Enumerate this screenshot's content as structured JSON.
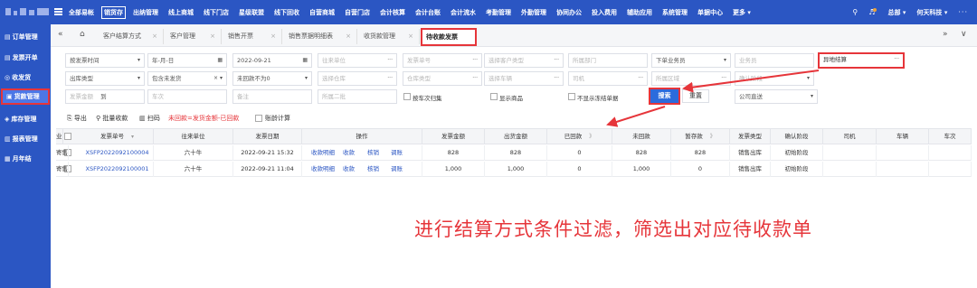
{
  "topbar": {
    "nav": [
      "全部易帐",
      "销货存",
      "出纳管理",
      "线上商城",
      "线下门店",
      "星级联盟",
      "线下回收",
      "自营商城",
      "自营门店",
      "会计核算",
      "会计台账",
      "会计流水",
      "考勤管理",
      "外勤管理",
      "协同办公",
      "投入费用",
      "辅助应用",
      "系统管理",
      "单据中心",
      "更多 ▾"
    ],
    "active_index": 1,
    "user": "总部 ▾",
    "company": "何天科技 ▾",
    "ellipsis": "···"
  },
  "sidebar": {
    "items": [
      {
        "icon": "▤",
        "label": "订单管理"
      },
      {
        "icon": "▤",
        "label": "发票开单"
      },
      {
        "icon": "◎",
        "label": "收发货"
      },
      {
        "icon": "▣",
        "label": "货款管理"
      },
      {
        "icon": "◈",
        "label": "库存管理"
      },
      {
        "icon": "▥",
        "label": "报表管理"
      },
      {
        "icon": "▦",
        "label": "月年结"
      }
    ],
    "active_index": 3
  },
  "tabs": {
    "back": "«",
    "forward": "»",
    "more": "∨",
    "items": [
      {
        "label": "客户结算方式",
        "close": "×"
      },
      {
        "label": "客户管理",
        "close": "×"
      },
      {
        "label": "销售开票",
        "close": "×"
      },
      {
        "label": "销售票据明细表",
        "close": "×"
      },
      {
        "label": "收货款管理",
        "close": "×"
      },
      {
        "label": "待收款发票",
        "close": "×"
      }
    ],
    "active_index": 5
  },
  "filters": {
    "row1": [
      {
        "text": "按发票时间",
        "suffix": "▾",
        "placeholder": false
      },
      {
        "text": "年-月-日",
        "suffix": "▦",
        "placeholder": false
      },
      {
        "text": "2022-09-21",
        "suffix": "▦",
        "placeholder": false
      },
      {
        "text": "往来单位",
        "suffix": "···",
        "placeholder": true
      },
      {
        "text": "发票单号",
        "suffix": "···",
        "placeholder": true
      },
      {
        "text": "选择客户类型",
        "suffix": "···",
        "placeholder": true
      },
      {
        "text": "所属部门",
        "suffix": "",
        "placeholder": true
      },
      {
        "text": "下单业务员",
        "suffix": "▾",
        "placeholder": false
      },
      {
        "text": "业务员",
        "suffix": "",
        "placeholder": true
      },
      {
        "text": "异地结算",
        "suffix": "···",
        "placeholder": false,
        "highlight": true
      }
    ],
    "row2": [
      {
        "text": "出库类型",
        "suffix": "▾",
        "placeholder": false
      },
      {
        "text": "包含未发货",
        "suffix": "×  ▾",
        "placeholder": false
      },
      {
        "text": "未回款不为0",
        "suffix": "▾",
        "placeholder": false
      },
      {
        "text": "选择仓库",
        "suffix": "···",
        "placeholder": true
      },
      {
        "text": "仓库类型",
        "suffix": "···",
        "placeholder": true
      },
      {
        "text": "选择车辆",
        "suffix": "···",
        "placeholder": true
      },
      {
        "text": "司机",
        "suffix": "···",
        "placeholder": true
      },
      {
        "text": "所属区域",
        "suffix": "···",
        "placeholder": true
      },
      {
        "text": "确认阶段",
        "suffix": "▾",
        "placeholder": true
      }
    ],
    "row3": {
      "amount_label": "发票金额",
      "amount_to": "到",
      "car_times": "车次",
      "remark": "备注",
      "level2": "所属二批",
      "group_by_car": "按车次归集",
      "show_goods": "显示商品",
      "hide_cleared": "不显示冻结单据",
      "search": "搜索",
      "reset": "重置",
      "company": "公司直送"
    }
  },
  "toolbar": {
    "export": "导出",
    "batch_collect": "批量收款",
    "scan": "扫码",
    "formula": "未回款=发货金额-已回款",
    "aging": "账龄计算"
  },
  "table": {
    "columns": [
      "发票单号",
      "往来单位",
      "发票日期",
      "操作",
      "发票金额",
      "出货金额",
      "已回款",
      "未回款",
      "暂存款",
      "发票类型",
      "确认阶段",
      "司机",
      "车辆",
      "车次",
      "业"
    ],
    "sort_marks": [
      "▾",
      "",
      "",
      "",
      "",
      "",
      "》",
      "",
      "》",
      "",
      "",
      "",
      "",
      "",
      ""
    ],
    "ops": [
      "收款明细",
      "收款",
      "核销",
      "调账"
    ],
    "rows": [
      {
        "no": "XSFP2022092100004",
        "unit": "六十牛",
        "date": "2022-09-21 15:32",
        "amount": "828",
        "out": "828",
        "paid": "0",
        "unpaid": "828",
        "temp": "828",
        "type": "销售出库",
        "stage": "初始阶段",
        "extra": "寄售"
      },
      {
        "no": "XSFP2022092100001",
        "unit": "六十牛",
        "date": "2022-09-21 11:04",
        "amount": "1,000",
        "out": "1,000",
        "paid": "0",
        "unpaid": "1,000",
        "temp": "0",
        "type": "销售出库",
        "stage": "初始阶段",
        "extra": "寄售"
      }
    ]
  },
  "annotation": "进行结算方式条件过滤，筛选出对应待收款单",
  "colors": {
    "primary": "#2b56c3",
    "highlight": "#e6353a",
    "link": "#2b56c3"
  }
}
